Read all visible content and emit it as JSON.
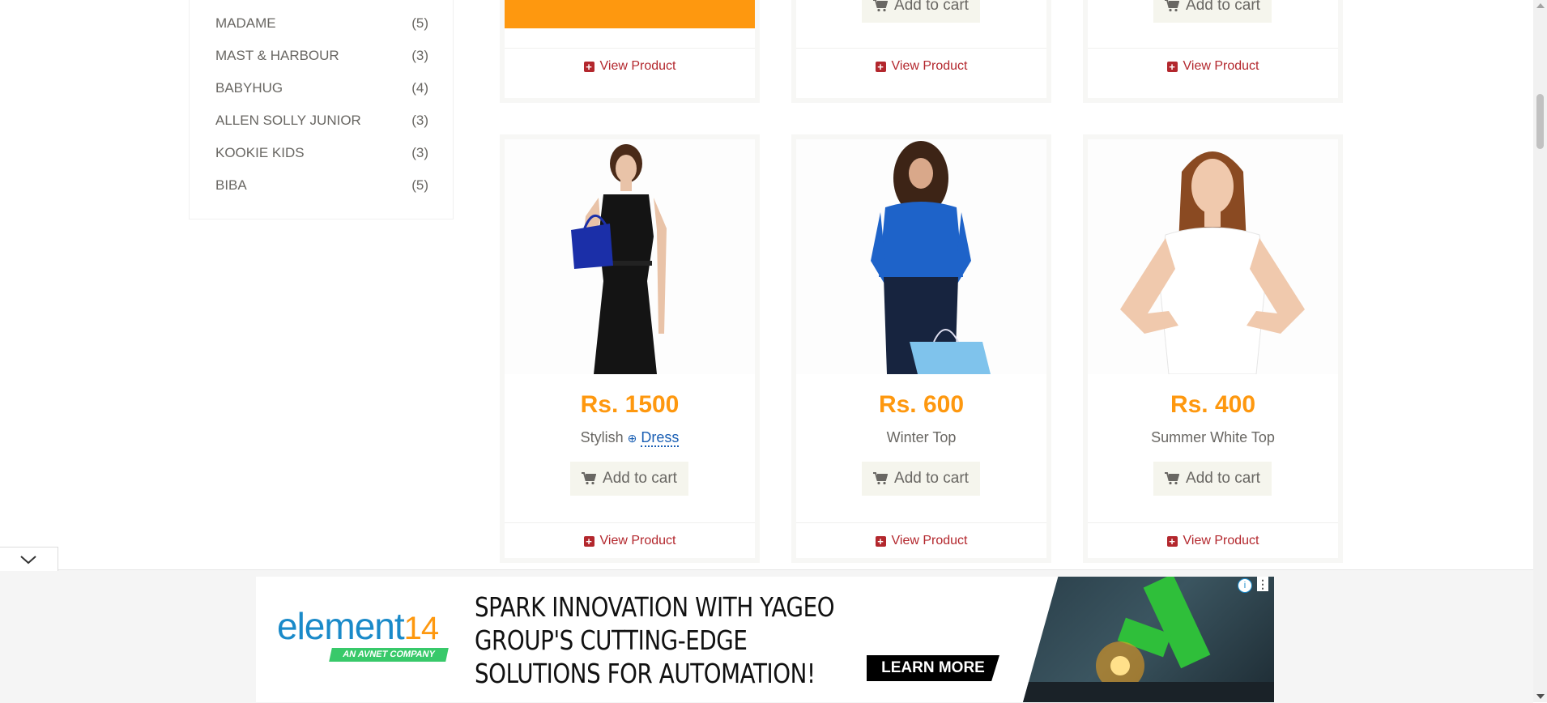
{
  "brands": [
    {
      "name": "MADAME",
      "count": "(5)"
    },
    {
      "name": "MAST & HARBOUR",
      "count": "(3)"
    },
    {
      "name": "BABYHUG",
      "count": "(4)"
    },
    {
      "name": "ALLEN SOLLY JUNIOR",
      "count": "(3)"
    },
    {
      "name": "KOOKIE KIDS",
      "count": "(3)"
    },
    {
      "name": "BIBA",
      "count": "(5)"
    }
  ],
  "top_cards": [
    {
      "cart_label": "",
      "view_label": "View Product"
    },
    {
      "cart_label": "Add to cart",
      "view_label": "View Product"
    },
    {
      "cart_label": "Add to cart",
      "view_label": "View Product"
    }
  ],
  "products": [
    {
      "price": "Rs. 1500",
      "name_prefix": "Stylish",
      "name_link": "Dress",
      "cart_label": "Add to cart",
      "view_label": "View Product",
      "image": "woman-black-dress"
    },
    {
      "price": "Rs. 600",
      "name": "Winter Top",
      "cart_label": "Add to cart",
      "view_label": "View Product",
      "image": "woman-blue-top"
    },
    {
      "price": "Rs. 400",
      "name": "Summer White Top",
      "cart_label": "Add to cart",
      "view_label": "View Product",
      "image": "woman-white-top"
    }
  ],
  "ad": {
    "brand": "element",
    "brand_num": "14",
    "tagline": "AN AVNET COMPANY",
    "headline": "SPARK INNOVATION WITH YAGEO GROUP'S CUTTING-EDGE SOLUTIONS FOR AUTOMATION!",
    "cta": "LEARN MORE",
    "info_icon": "i",
    "menu_icon": "⋮"
  },
  "colors": {
    "price": "#FE980F",
    "view_link": "#B3272D",
    "button_bg": "#F5F5ED",
    "accent_orange": "#FE980F"
  }
}
